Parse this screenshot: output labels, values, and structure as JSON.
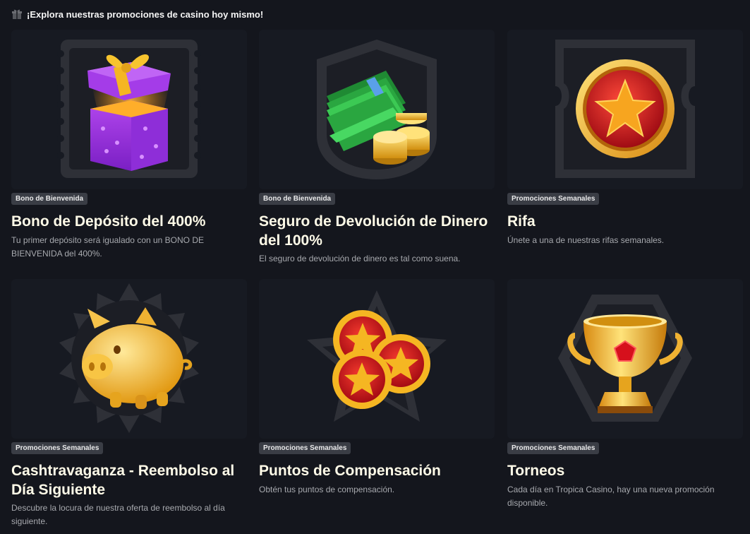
{
  "header": {
    "title": "¡Explora nuestras promociones de casino hoy mismo!",
    "icon": "gift-icon"
  },
  "promotions": [
    {
      "badge": "Bono de Bienvenida",
      "title": "Bono de Depósito del 400%",
      "description": "Tu primer depósito será igualado con un BONO DE BIENVENIDA del 400%.",
      "icon": "gift-box-icon"
    },
    {
      "badge": "Bono de Bienvenida",
      "title": "Seguro de Devolución de Dinero del 100%",
      "description": "El seguro de devolución de dinero es tal como suena.",
      "icon": "cash-coins-icon"
    },
    {
      "badge": "Promociones Semanales",
      "title": "Rifa",
      "description": "Únete a una de nuestras rifas semanales.",
      "icon": "star-medal-icon"
    },
    {
      "badge": "Promociones Semanales",
      "title": "Cashtravaganza - Reembolso al Día Siguiente",
      "description": "Descubre la locura de nuestra oferta de reembolso al día siguiente.",
      "icon": "piggy-bank-icon"
    },
    {
      "badge": "Promociones Semanales",
      "title": "Puntos de Compensación",
      "description": "Obtén tus puntos de compensación.",
      "icon": "star-coins-icon"
    },
    {
      "badge": "Promociones Semanales",
      "title": "Torneos",
      "description": "Cada día en Tropica Casino, hay una nueva promoción disponible.",
      "icon": "trophy-icon"
    }
  ],
  "colors": {
    "background": "#14161d",
    "card_background": "#171a22",
    "badge_background": "#3a3d45",
    "title": "#fffbe8",
    "description": "#a7a9ae",
    "gold": "#f5b622",
    "red": "#c8141c"
  }
}
